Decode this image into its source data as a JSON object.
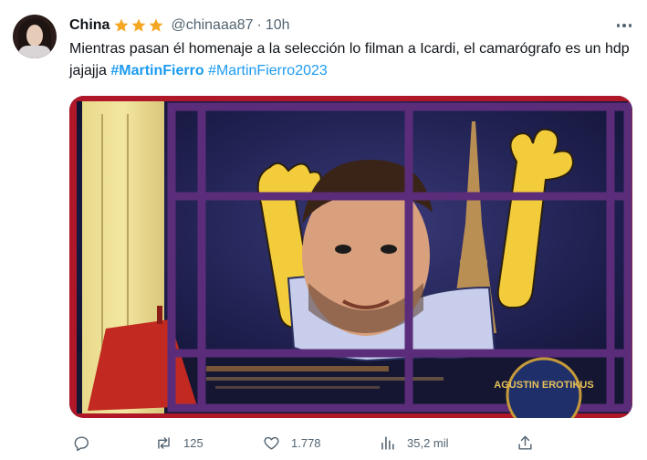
{
  "tweet": {
    "author_name": "China",
    "handle": "@chinaaa87",
    "separator": "·",
    "time": "10h",
    "text_prefix": "Mientras pasan él homenaje a la selección lo filman a Icardi, el camarógrafo es un hdp jajajja ",
    "hashtag1": "#MartinFierro",
    "hashtag2": "#MartinFierro2023"
  },
  "media": {
    "watermark": "AGUSTIN EROTIKUS"
  },
  "actions": {
    "replies": "",
    "retweets": "125",
    "likes": "1.778",
    "views": "35,2 mil"
  },
  "icons": {
    "stars": [
      "star-icon",
      "star-icon",
      "star-icon"
    ],
    "more": "more-icon",
    "reply": "reply-icon",
    "retweet": "retweet-icon",
    "like": "heart-icon",
    "views": "views-icon",
    "share": "share-icon"
  },
  "colors": {
    "text": "#0f1419",
    "muted": "#536471",
    "link": "#1d9bf0",
    "star": "#f5a623"
  }
}
